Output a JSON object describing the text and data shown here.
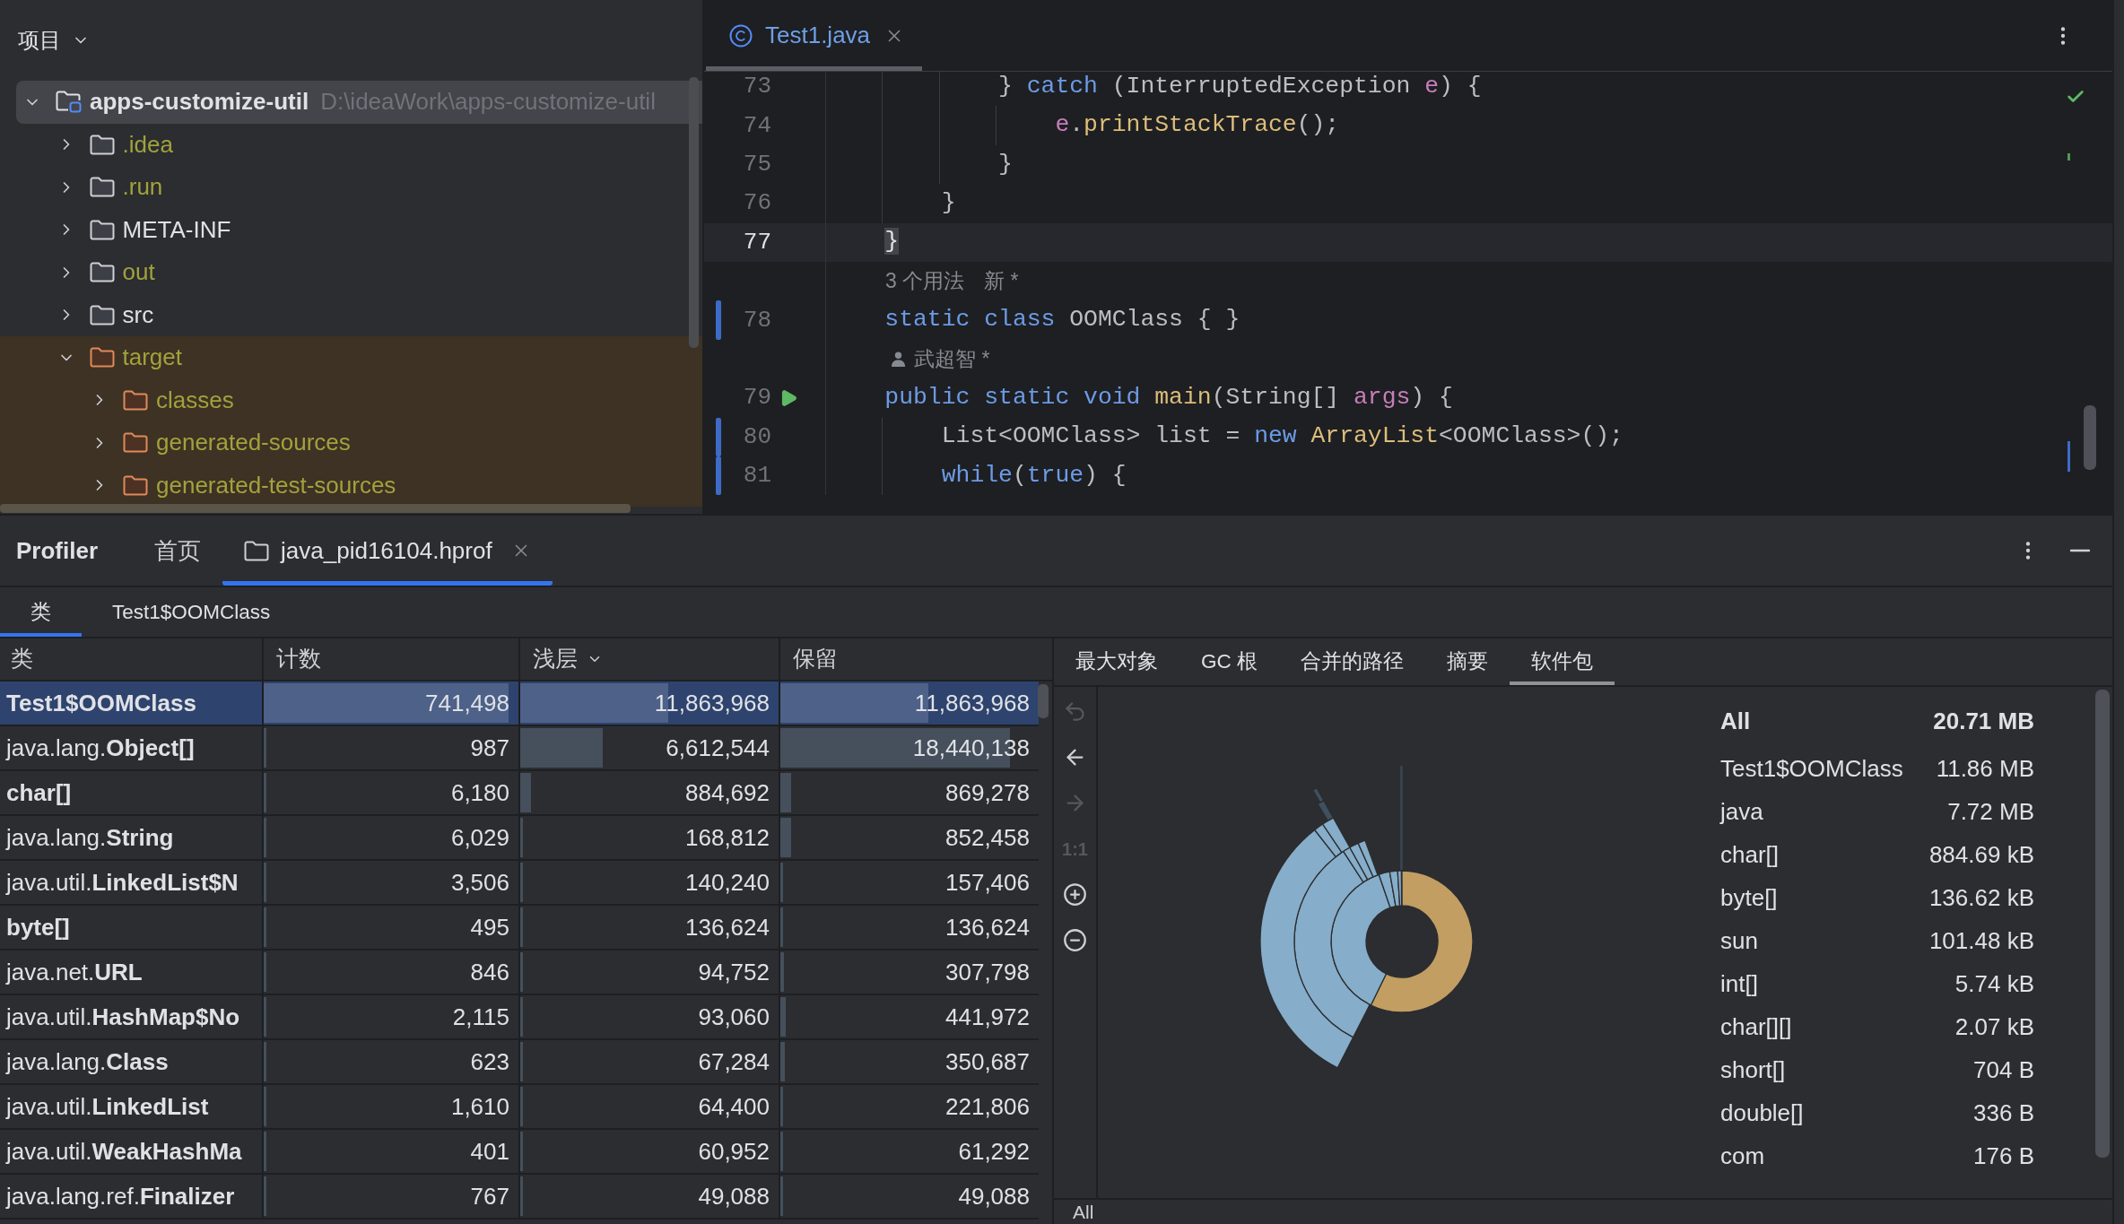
{
  "project_panel": {
    "title": "项目",
    "tree": [
      {
        "name": "apps-customize-util",
        "path": "D:\\ideaWork\\apps-customize-util",
        "kind": "module",
        "expanded": true,
        "selected": true,
        "ignored": false,
        "excluded": false,
        "children": [
          {
            "name": ".idea",
            "kind": "folder",
            "expanded": false,
            "selected": false,
            "ignored": true,
            "excluded": false
          },
          {
            "name": ".run",
            "kind": "folder",
            "expanded": false,
            "selected": false,
            "ignored": true,
            "excluded": false
          },
          {
            "name": "META-INF",
            "kind": "folder",
            "expanded": false,
            "selected": false,
            "ignored": false,
            "excluded": false
          },
          {
            "name": "out",
            "kind": "folder",
            "expanded": false,
            "selected": false,
            "ignored": true,
            "excluded": false
          },
          {
            "name": "src",
            "kind": "folder",
            "expanded": false,
            "selected": false,
            "ignored": false,
            "excluded": false
          },
          {
            "name": "target",
            "kind": "folder",
            "expanded": true,
            "selected": false,
            "ignored": true,
            "excluded": true,
            "children": [
              {
                "name": "classes",
                "kind": "folder",
                "expanded": false,
                "selected": false,
                "ignored": true,
                "excluded": true
              },
              {
                "name": "generated-sources",
                "kind": "folder",
                "expanded": false,
                "selected": false,
                "ignored": true,
                "excluded": true
              },
              {
                "name": "generated-test-sources",
                "kind": "folder",
                "expanded": false,
                "selected": false,
                "ignored": true,
                "excluded": true
              }
            ]
          }
        ]
      }
    ]
  },
  "editor": {
    "tabs": [
      {
        "label": "Test1.java",
        "selected": true,
        "modified": true
      }
    ],
    "lines": [
      {
        "kind": "code",
        "number": "73",
        "current": false,
        "changed": false,
        "runnable": false,
        "tokens": [
          {
            "kind": "plain",
            "text": "            } "
          },
          {
            "kind": "keyword",
            "text": "catch"
          },
          {
            "kind": "plain",
            "text": " (InterruptedException "
          },
          {
            "kind": "param",
            "text": "e"
          },
          {
            "kind": "plain",
            "text": ") {"
          }
        ]
      },
      {
        "kind": "code",
        "number": "74",
        "current": false,
        "changed": false,
        "runnable": false,
        "tokens": [
          {
            "kind": "param",
            "text": "                e"
          },
          {
            "kind": "plain",
            "text": "."
          },
          {
            "kind": "method",
            "text": "printStackTrace"
          },
          {
            "kind": "plain",
            "text": "();"
          }
        ]
      },
      {
        "kind": "code",
        "number": "75",
        "current": false,
        "changed": false,
        "runnable": false,
        "tokens": [
          {
            "kind": "plain",
            "text": "            }"
          }
        ]
      },
      {
        "kind": "code",
        "number": "76",
        "current": false,
        "changed": false,
        "runnable": false,
        "tokens": [
          {
            "kind": "plain",
            "text": "        }"
          }
        ]
      },
      {
        "kind": "code",
        "number": "77",
        "current": true,
        "changed": false,
        "runnable": false,
        "tokens": [
          {
            "kind": "matched-brace",
            "text": "    }"
          }
        ]
      },
      {
        "kind": "hints",
        "items": [
          "3 个用法",
          "新 *"
        ]
      },
      {
        "kind": "code",
        "number": "78",
        "current": false,
        "changed": true,
        "runnable": false,
        "tokens": [
          {
            "kind": "keyword",
            "text": "    static class"
          },
          {
            "kind": "plain",
            "text": " OOMClass { }"
          }
        ]
      },
      {
        "kind": "author",
        "text": "武超智 *"
      },
      {
        "kind": "code",
        "number": "79",
        "current": false,
        "changed": false,
        "runnable": true,
        "tokens": [
          {
            "kind": "keyword",
            "text": "    public static void "
          },
          {
            "kind": "method",
            "text": "main"
          },
          {
            "kind": "plain",
            "text": "(String[] "
          },
          {
            "kind": "param",
            "text": "args"
          },
          {
            "kind": "plain",
            "text": ") {"
          }
        ]
      },
      {
        "kind": "code",
        "number": "80",
        "current": false,
        "changed": true,
        "runnable": false,
        "tokens": [
          {
            "kind": "plain",
            "text": "        List<OOMClass> list = "
          },
          {
            "kind": "keyword",
            "text": "new "
          },
          {
            "kind": "constructor",
            "text": "ArrayList"
          },
          {
            "kind": "plain",
            "text": "<OOMClass>();"
          }
        ]
      },
      {
        "kind": "code",
        "number": "81",
        "current": false,
        "changed": true,
        "runnable": false,
        "tokens": [
          {
            "kind": "keyword",
            "text": "        while"
          },
          {
            "kind": "plain",
            "text": "("
          },
          {
            "kind": "keyword",
            "text": "true"
          },
          {
            "kind": "plain",
            "text": ") {"
          }
        ]
      }
    ]
  },
  "profiler": {
    "title": "Profiler",
    "tabs": [
      {
        "label": "首页",
        "kind": "home",
        "selected": false
      },
      {
        "label": "java_pid16104.hprof",
        "kind": "file",
        "selected": true
      }
    ],
    "view_tabs": [
      {
        "label": "类",
        "selected": true
      },
      {
        "label": "Test1$OOMClass",
        "selected": false
      }
    ],
    "table": {
      "columns": [
        {
          "label": "类",
          "sorted": false
        },
        {
          "label": "计数",
          "sorted": false
        },
        {
          "label": "浅层",
          "sorted": true
        },
        {
          "label": "保留",
          "sorted": false
        }
      ],
      "rows": [
        {
          "name": "Test1$OOMClass",
          "selected": true,
          "cells": [
            {
              "value": "741,498",
              "level": 0.96
            },
            {
              "value": "11,863,968",
              "level": 0.573
            },
            {
              "value": "11,863,968",
              "level": 0.573
            }
          ]
        },
        {
          "package": "java.lang.",
          "name": "Object[]",
          "selected": false,
          "cells": [
            {
              "value": "987",
              "level": 0.0013
            },
            {
              "value": "6,612,544",
              "level": 0.319
            },
            {
              "value": "18,440,138",
              "level": 0.89
            }
          ]
        },
        {
          "name": "char[]",
          "selected": false,
          "cells": [
            {
              "value": "6,180",
              "level": 0.008
            },
            {
              "value": "884,692",
              "level": 0.0427
            },
            {
              "value": "869,278",
              "level": 0.042
            }
          ]
        },
        {
          "package": "java.lang.",
          "name": "String",
          "selected": false,
          "cells": [
            {
              "value": "6,029",
              "level": 0.0078
            },
            {
              "value": "168,812",
              "level": 0.0082
            },
            {
              "value": "852,458",
              "level": 0.0412
            }
          ]
        },
        {
          "package": "java.util.",
          "name": "LinkedList$N",
          "selected": false,
          "cells": [
            {
              "value": "3,506",
              "level": 0.0045
            },
            {
              "value": "140,240",
              "level": 0.0068
            },
            {
              "value": "157,406",
              "level": 0.0076
            }
          ]
        },
        {
          "name": "byte[]",
          "selected": false,
          "cells": [
            {
              "value": "495",
              "level": 0.0006
            },
            {
              "value": "136,624",
              "level": 0.0066
            },
            {
              "value": "136,624",
              "level": 0.0066
            }
          ]
        },
        {
          "package": "java.net.",
          "name": "URL",
          "selected": false,
          "cells": [
            {
              "value": "846",
              "level": 0.0011
            },
            {
              "value": "94,752",
              "level": 0.0046
            },
            {
              "value": "307,798",
              "level": 0.0149
            }
          ]
        },
        {
          "package": "java.util.",
          "name": "HashMap$No",
          "selected": false,
          "cells": [
            {
              "value": "2,115",
              "level": 0.0027
            },
            {
              "value": "93,060",
              "level": 0.0045
            },
            {
              "value": "441,972",
              "level": 0.0213
            }
          ]
        },
        {
          "package": "java.lang.",
          "name": "Class",
          "selected": false,
          "cells": [
            {
              "value": "623",
              "level": 0.0008
            },
            {
              "value": "67,284",
              "level": 0.0032
            },
            {
              "value": "350,687",
              "level": 0.0169
            }
          ]
        },
        {
          "package": "java.util.",
          "name": "LinkedList",
          "selected": false,
          "cells": [
            {
              "value": "1,610",
              "level": 0.0021
            },
            {
              "value": "64,400",
              "level": 0.0031
            },
            {
              "value": "221,806",
              "level": 0.0107
            }
          ]
        },
        {
          "package": "java.util.",
          "name": "WeakHashMa",
          "selected": false,
          "cells": [
            {
              "value": "401",
              "level": 0.0005
            },
            {
              "value": "60,952",
              "level": 0.0029
            },
            {
              "value": "61,292",
              "level": 0.003
            }
          ]
        },
        {
          "package": "java.lang.ref.",
          "name": "Finalizer",
          "selected": false,
          "cells": [
            {
              "value": "767",
              "level": 0.001
            },
            {
              "value": "49,088",
              "level": 0.0024
            },
            {
              "value": "49,088",
              "level": 0.0024
            }
          ]
        }
      ]
    }
  },
  "details": {
    "tabs": [
      {
        "label": "最大对象",
        "selected": false
      },
      {
        "label": "GC 根",
        "selected": false
      },
      {
        "label": "合并的路径",
        "selected": false
      },
      {
        "label": "摘要",
        "selected": false
      },
      {
        "label": "软件包",
        "selected": true
      }
    ],
    "toolbar": [
      {
        "kind": "undo",
        "disabled": true
      },
      {
        "kind": "back",
        "disabled": false
      },
      {
        "kind": "forward",
        "disabled": true
      },
      {
        "kind": "actual-size",
        "label": "1:1",
        "disabled": true
      },
      {
        "kind": "zoom-in",
        "disabled": false
      },
      {
        "kind": "zoom-out",
        "disabled": false
      }
    ],
    "legend": [
      {
        "kind": "total",
        "name": "All",
        "size": "20.71 MB"
      },
      {
        "kind": "entry",
        "name": "Test1$OOMClass",
        "size": "11.86 MB"
      },
      {
        "kind": "entry",
        "name": "java",
        "size": "7.72 MB"
      },
      {
        "kind": "entry",
        "name": "char[]",
        "size": "884.69 kB"
      },
      {
        "kind": "entry",
        "name": "byte[]",
        "size": "136.62 kB"
      },
      {
        "kind": "entry",
        "name": "sun",
        "size": "101.48 kB"
      },
      {
        "kind": "entry",
        "name": "int[]",
        "size": "5.74 kB"
      },
      {
        "kind": "entry",
        "name": "char[][]",
        "size": "2.07 kB"
      },
      {
        "kind": "entry",
        "name": "short[]",
        "size": "704 B"
      },
      {
        "kind": "entry",
        "name": "double[]",
        "size": "336 B"
      },
      {
        "kind": "entry",
        "name": "com",
        "size": "176 B"
      }
    ],
    "breadcrumb": "All"
  }
}
